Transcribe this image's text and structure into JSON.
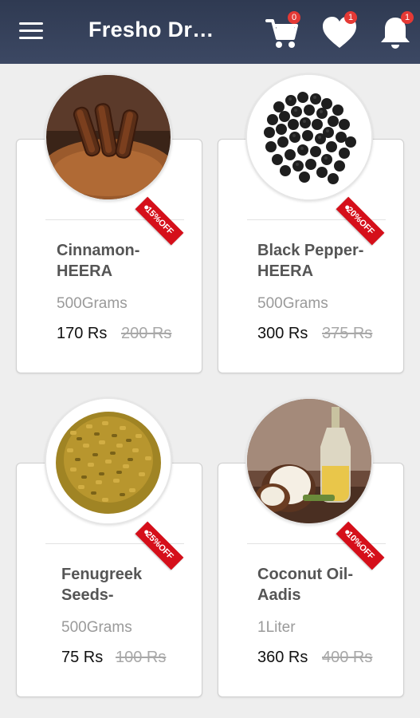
{
  "app": {
    "title": "Fresho Dry…"
  },
  "header": {
    "menu_icon": "hamburger-menu-icon",
    "cart": {
      "icon": "shopping-cart-icon",
      "badge": "0"
    },
    "wishlist": {
      "icon": "heart-icon",
      "badge": "1"
    },
    "notifications": {
      "icon": "bell-icon",
      "badge": "1"
    }
  },
  "colors": {
    "appbar": "#2f3a52",
    "badge": "#e53935",
    "discount_tag": "#d50f1a"
  },
  "products": [
    {
      "name": "Cinnamon-HEERA",
      "name_line1": "Cinnamon-",
      "name_line2": "HEERA",
      "quantity": "500Grams",
      "price": "170 Rs",
      "old_price": "200 Rs",
      "discount": "15%OFF",
      "image": "cinnamon"
    },
    {
      "name": "Black Pepper-HEERA",
      "name_line1": "Black Pepper-",
      "name_line2": "HEERA",
      "quantity": "500Grams",
      "price": "300 Rs",
      "old_price": "375 Rs",
      "discount": "20%OFF",
      "image": "black-pepper"
    },
    {
      "name": "Fenugreek Seeds-",
      "name_line1": "Fenugreek",
      "name_line2": "Seeds-",
      "quantity": "500Grams",
      "price": "75 Rs",
      "old_price": "100 Rs",
      "discount": "25%OFF",
      "image": "fenugreek-seeds"
    },
    {
      "name": "Coconut Oil-Aadis",
      "name_line1": "Coconut Oil-",
      "name_line2": "Aadis",
      "quantity": "1Liter",
      "price": "360 Rs",
      "old_price": "400 Rs",
      "discount": "10%OFF",
      "image": "coconut-oil"
    }
  ]
}
